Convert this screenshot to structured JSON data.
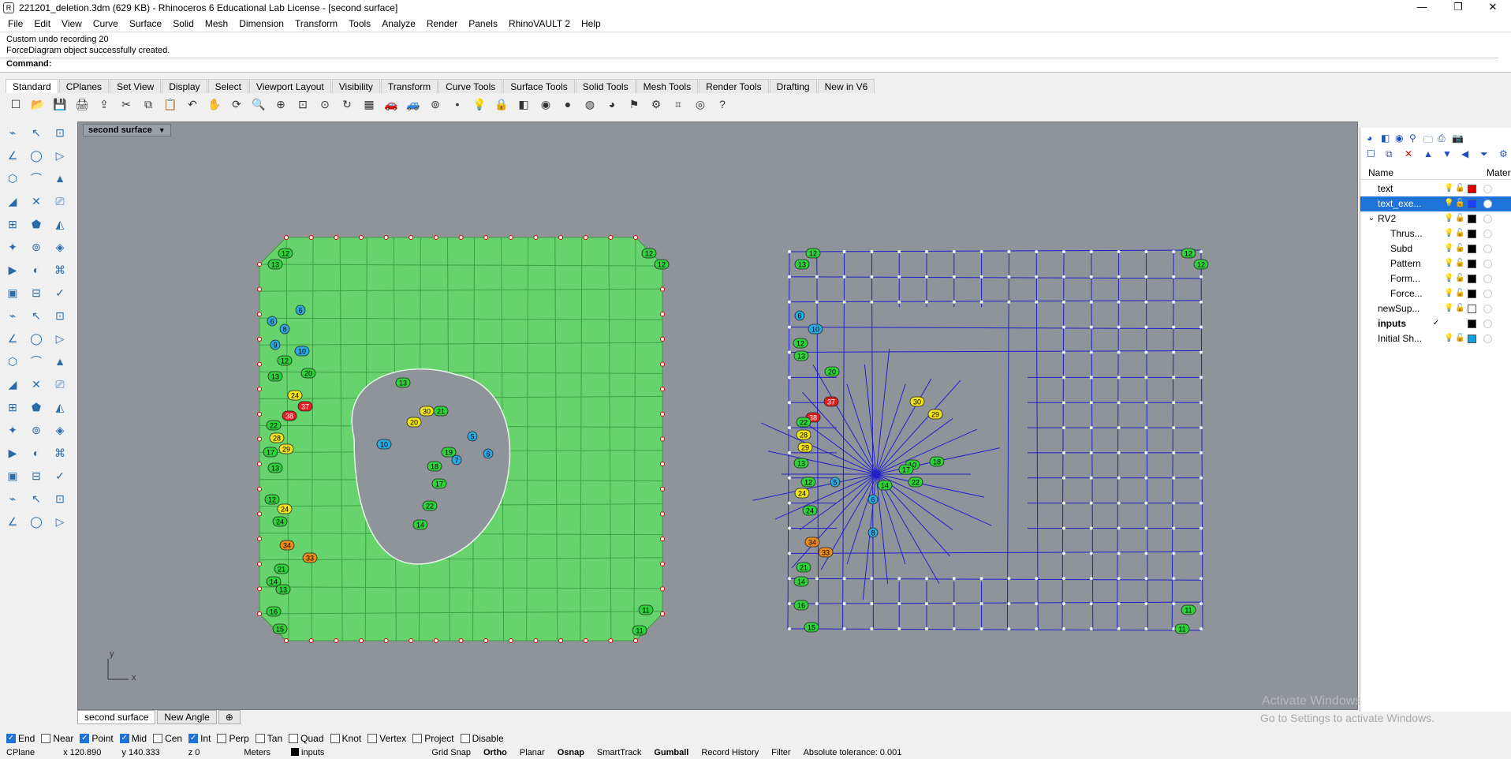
{
  "window": {
    "title": "221201_deletion.3dm (629 KB) - Rhinoceros 6 Educational Lab License - [second surface]",
    "minimize": "—",
    "maximize": "❐",
    "close": "✕"
  },
  "menu": [
    "File",
    "Edit",
    "View",
    "Curve",
    "Surface",
    "Solid",
    "Mesh",
    "Dimension",
    "Transform",
    "Tools",
    "Analyze",
    "Render",
    "Panels",
    "RhinoVAULT 2",
    "Help"
  ],
  "command_history": [
    "Custom undo recording 20",
    "ForceDiagram object successfully created."
  ],
  "command_prompt": "Command:",
  "toolbar_tabs": [
    "Standard",
    "CPlanes",
    "Set View",
    "Display",
    "Select",
    "Viewport Layout",
    "Visibility",
    "Transform",
    "Curve Tools",
    "Surface Tools",
    "Solid Tools",
    "Mesh Tools",
    "Render Tools",
    "Drafting",
    "New in V6"
  ],
  "toolbar_icons": [
    "new-icon",
    "open-icon",
    "save-icon",
    "print-icon",
    "import-icon",
    "cut-icon",
    "copy-icon",
    "paste-icon",
    "undo-icon",
    "pan-icon",
    "rotate-view-icon",
    "zoom-icon",
    "zoom-window-icon",
    "zoom-extents-icon",
    "zoom-selected-icon",
    "rotate-icon",
    "grid-icon",
    "car-icon",
    "car2-icon",
    "snap-icon",
    "point-icon",
    "light-icon",
    "lock-icon",
    "layer-icon",
    "color-wheel-icon",
    "sphere-icon",
    "sphere2-icon",
    "sphere3-icon",
    "filter-icon",
    "gear-icon",
    "axes-icon",
    "globe-icon",
    "help-icon"
  ],
  "viewport": {
    "title": "second surface",
    "axis_y": "y",
    "axis_x": "x"
  },
  "watermark": [
    "Activate Windows",
    "Go to Settings to activate Windows."
  ],
  "layers_panel": {
    "header_name": "Name",
    "header_material": "Materi",
    "layers": [
      {
        "name": "text",
        "color": "#e00000",
        "indent": 1,
        "selected": false,
        "bold": false
      },
      {
        "name": "text_exe...",
        "color": "#1e40ff",
        "indent": 1,
        "selected": true,
        "bold": false
      },
      {
        "name": "RV2",
        "color": "#000000",
        "indent": 1,
        "selected": false,
        "bold": false,
        "expander": "v"
      },
      {
        "name": "Thrus...",
        "color": "#000000",
        "indent": 2,
        "selected": false,
        "bold": false
      },
      {
        "name": "Subd",
        "color": "#000000",
        "indent": 2,
        "selected": false,
        "bold": false
      },
      {
        "name": "Pattern",
        "color": "#000000",
        "indent": 2,
        "selected": false,
        "bold": false
      },
      {
        "name": "Form...",
        "color": "#000000",
        "indent": 2,
        "selected": false,
        "bold": false
      },
      {
        "name": "Force...",
        "color": "#000000",
        "indent": 2,
        "selected": false,
        "bold": false
      },
      {
        "name": "newSup...",
        "color": "#ffffff",
        "indent": 1,
        "selected": false,
        "bold": false
      },
      {
        "name": "inputs",
        "color": "#000000",
        "indent": 1,
        "selected": false,
        "bold": true,
        "current": "✓"
      },
      {
        "name": "Initial Sh...",
        "color": "#1aa0d8",
        "indent": 1,
        "selected": false,
        "bold": false
      }
    ]
  },
  "view_tabs": [
    "second surface",
    "New Angle"
  ],
  "view_tab_add": "⊕",
  "osnaps": [
    {
      "label": "End",
      "checked": true
    },
    {
      "label": "Near",
      "checked": false
    },
    {
      "label": "Point",
      "checked": true
    },
    {
      "label": "Mid",
      "checked": true
    },
    {
      "label": "Cen",
      "checked": false
    },
    {
      "label": "Int",
      "checked": true
    },
    {
      "label": "Perp",
      "checked": false
    },
    {
      "label": "Tan",
      "checked": false
    },
    {
      "label": "Quad",
      "checked": false
    },
    {
      "label": "Knot",
      "checked": false
    },
    {
      "label": "Vertex",
      "checked": false
    },
    {
      "label": "Project",
      "checked": false
    },
    {
      "label": "Disable",
      "checked": false
    }
  ],
  "status": {
    "cplane": "CPlane",
    "x": "x 120.890",
    "y": "y 140.333",
    "z": "z 0",
    "units": "Meters",
    "layer": "inputs",
    "grid_snap": "Grid Snap",
    "ortho": "Ortho",
    "planar": "Planar",
    "osnap": "Osnap",
    "smarttrack": "SmartTrack",
    "gumball": "Gumball",
    "record_history": "Record History",
    "filter": "Filter",
    "tolerance": "Absolute tolerance: 0.001"
  },
  "colors": {
    "viewport_bg": "#8f949b",
    "form_fill": "#66d36c",
    "force_lines": "#2020c8",
    "label_green": "#2fd13a",
    "label_blue": "#2aa8e0",
    "label_yellow": "#f2e21a",
    "label_orange": "#e98a1c",
    "label_red": "#e02020"
  },
  "form_labels": [
    {
      "t": "12",
      "c": "g"
    },
    {
      "t": "13",
      "c": "g"
    },
    {
      "t": "12",
      "c": "g"
    },
    {
      "t": "12",
      "c": "g"
    },
    {
      "t": "6",
      "c": "b"
    },
    {
      "t": "6",
      "c": "b"
    },
    {
      "t": "8",
      "c": "b"
    },
    {
      "t": "9",
      "c": "b"
    },
    {
      "t": "10",
      "c": "b"
    },
    {
      "t": "12",
      "c": "g"
    },
    {
      "t": "13",
      "c": "g"
    },
    {
      "t": "20",
      "c": "g"
    },
    {
      "t": "24",
      "c": "y"
    },
    {
      "t": "37",
      "c": "r"
    },
    {
      "t": "38",
      "c": "r"
    },
    {
      "t": "22",
      "c": "g"
    },
    {
      "t": "28",
      "c": "y"
    },
    {
      "t": "29",
      "c": "y"
    },
    {
      "t": "17",
      "c": "g"
    },
    {
      "t": "13",
      "c": "g"
    },
    {
      "t": "12",
      "c": "g"
    },
    {
      "t": "24",
      "c": "y"
    },
    {
      "t": "24",
      "c": "g"
    },
    {
      "t": "34",
      "c": "o"
    },
    {
      "t": "33",
      "c": "o"
    },
    {
      "t": "21",
      "c": "g"
    },
    {
      "t": "14",
      "c": "g"
    },
    {
      "t": "13",
      "c": "g"
    },
    {
      "t": "16",
      "c": "g"
    },
    {
      "t": "15",
      "c": "g"
    },
    {
      "t": "11",
      "c": "g"
    },
    {
      "t": "11",
      "c": "g"
    },
    {
      "t": "30",
      "c": "y"
    },
    {
      "t": "20",
      "c": "y"
    },
    {
      "t": "21",
      "c": "g"
    },
    {
      "t": "19",
      "c": "g"
    },
    {
      "t": "18",
      "c": "g"
    },
    {
      "t": "17",
      "c": "g"
    },
    {
      "t": "22",
      "c": "g"
    },
    {
      "t": "14",
      "c": "g"
    },
    {
      "t": "10",
      "c": "b"
    },
    {
      "t": "13",
      "c": "g"
    },
    {
      "t": "5",
      "c": "b"
    },
    {
      "t": "7",
      "c": "b"
    },
    {
      "t": "6",
      "c": "b"
    }
  ],
  "force_labels": [
    {
      "t": "12",
      "c": "g"
    },
    {
      "t": "13",
      "c": "g"
    },
    {
      "t": "12",
      "c": "g"
    },
    {
      "t": "12",
      "c": "g"
    },
    {
      "t": "6",
      "c": "b"
    },
    {
      "t": "10",
      "c": "b"
    },
    {
      "t": "12",
      "c": "g"
    },
    {
      "t": "13",
      "c": "g"
    },
    {
      "t": "20",
      "c": "g"
    },
    {
      "t": "37",
      "c": "r"
    },
    {
      "t": "38",
      "c": "r"
    },
    {
      "t": "22",
      "c": "g"
    },
    {
      "t": "28",
      "c": "y"
    },
    {
      "t": "29",
      "c": "y"
    },
    {
      "t": "13",
      "c": "g"
    },
    {
      "t": "12",
      "c": "g"
    },
    {
      "t": "24",
      "c": "y"
    },
    {
      "t": "24",
      "c": "g"
    },
    {
      "t": "34",
      "c": "o"
    },
    {
      "t": "33",
      "c": "o"
    },
    {
      "t": "21",
      "c": "g"
    },
    {
      "t": "14",
      "c": "g"
    },
    {
      "t": "16",
      "c": "g"
    },
    {
      "t": "15",
      "c": "g"
    },
    {
      "t": "11",
      "c": "g"
    },
    {
      "t": "11",
      "c": "g"
    },
    {
      "t": "30",
      "c": "y"
    },
    {
      "t": "29",
      "c": "y"
    },
    {
      "t": "22",
      "c": "g"
    },
    {
      "t": "14",
      "c": "g"
    },
    {
      "t": "18",
      "c": "g"
    },
    {
      "t": "10",
      "c": "g"
    },
    {
      "t": "17",
      "c": "g"
    },
    {
      "t": "6",
      "c": "b"
    },
    {
      "t": "5",
      "c": "b"
    },
    {
      "t": "8",
      "c": "b"
    }
  ]
}
